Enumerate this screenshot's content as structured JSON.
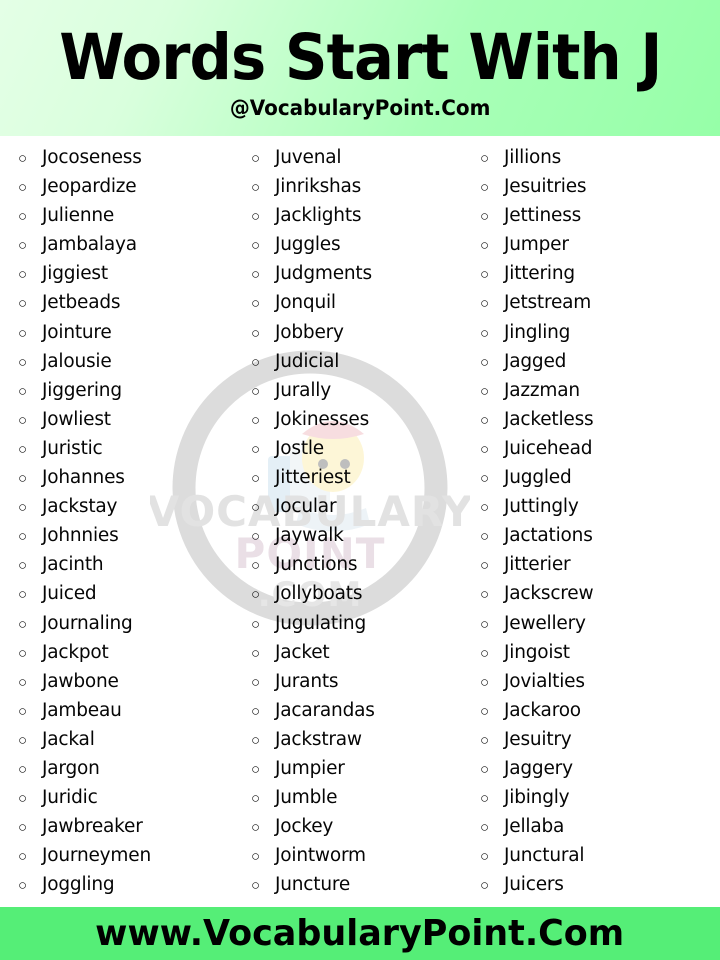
{
  "header": {
    "title": "Words Start With J",
    "subtitle": "@VocabularyPoint.Com",
    "gradient_from": "#e4ffe6",
    "gradient_to": "#96ffa8"
  },
  "watermark": {
    "line1": "VOCABULARY",
    "line2": "POINT",
    "line3": ".COM",
    "color": "#e0e0e0"
  },
  "footer": {
    "text": "www.VocabularyPoint.Com",
    "background": "#55ee77"
  },
  "list": {
    "bullet": "○",
    "columns": [
      {
        "index": 1,
        "words": [
          "Jocoseness",
          "Jeopardize",
          "Julienne",
          "Jambalaya",
          "Jiggiest",
          "Jetbeads",
          "Jointure",
          "Jalousie",
          "Jiggering",
          "Jowliest",
          "Juristic",
          "Johannes",
          "Jackstay",
          "Johnnies",
          "Jacinth",
          "Juiced",
          "Journaling",
          "Jackpot",
          "Jawbone",
          "Jambeau",
          "Jackal",
          "Jargon",
          "Juridic",
          "Jawbreaker",
          "Journeymen",
          "Joggling"
        ]
      },
      {
        "index": 2,
        "words": [
          "Juvenal",
          "Jinrikshas",
          "Jacklights",
          "Juggles",
          "Judgments",
          "Jonquil",
          "Jobbery",
          "Judicial",
          "Jurally",
          "Jokinesses",
          "Jostle",
          "Jitteriest",
          "Jocular",
          "Jaywalk",
          "Junctions",
          "Jollyboats",
          "Jugulating",
          "Jacket",
          "Jurants",
          "Jacarandas",
          "Jackstraw",
          "Jumpier",
          "Jumble",
          "Jockey",
          "Jointworm",
          "Juncture"
        ]
      },
      {
        "index": 3,
        "words": [
          "Jillions",
          "Jesuitries",
          "Jettiness",
          "Jumper",
          "Jittering",
          "Jetstream",
          "Jingling",
          "Jagged",
          "Jazzman",
          "Jacketless",
          "Juicehead",
          "Juggled",
          "Juttingly",
          "Jactations",
          "Jitterier",
          "Jackscrew",
          "Jewellery",
          "Jingoist",
          "Jovialties",
          "Jackaroo",
          "Jesuitry",
          "Jaggery",
          "Jibingly",
          "Jellaba",
          "Junctural",
          "Juicers"
        ]
      }
    ]
  }
}
